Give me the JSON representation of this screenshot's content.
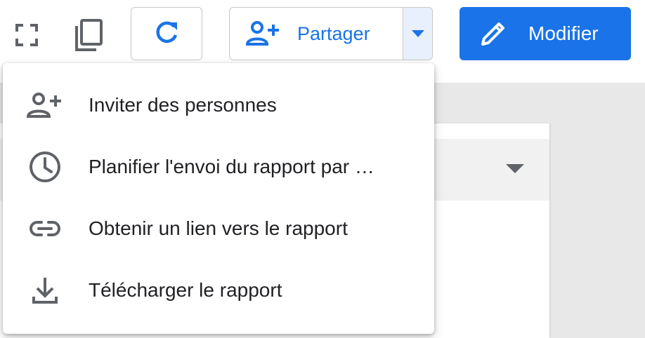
{
  "toolbar": {
    "fullscreen_icon": "fullscreen-icon",
    "copy_icon": "copy-icon",
    "refresh_icon": "refresh-icon",
    "share_label": "Partager",
    "share_icon": "person-add-icon",
    "share_dropdown_icon": "caret-down-icon",
    "edit_label": "Modifier",
    "edit_icon": "pencil-icon"
  },
  "share_menu": {
    "items": [
      {
        "label": "Inviter des personnes",
        "icon": "person-add-icon"
      },
      {
        "label": "Planifier l'envoi du rapport par …",
        "icon": "clock-icon"
      },
      {
        "label": "Obtenir un lien vers le rapport",
        "icon": "link-icon"
      },
      {
        "label": "Télécharger le rapport",
        "icon": "download-icon"
      }
    ]
  },
  "colors": {
    "accent": "#1a73e8",
    "icon_gray": "#5f6368"
  }
}
